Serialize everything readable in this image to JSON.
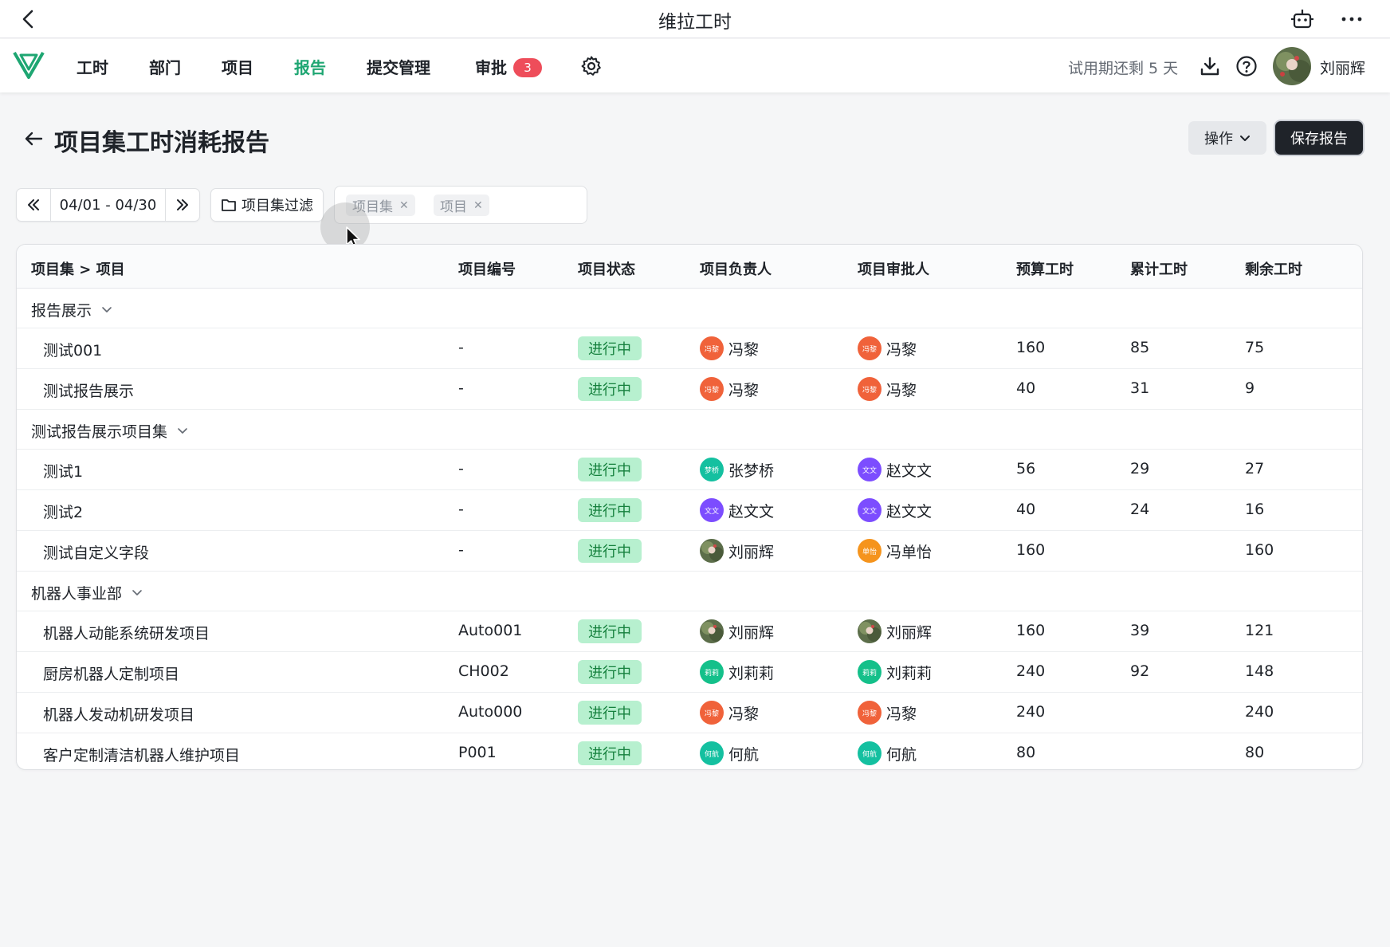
{
  "app": {
    "title": "维拉工时"
  },
  "nav": {
    "items": [
      {
        "label": "工时",
        "active": false
      },
      {
        "label": "部门",
        "active": false
      },
      {
        "label": "项目",
        "active": false
      },
      {
        "label": "报告",
        "active": true
      },
      {
        "label": "提交管理",
        "active": false
      },
      {
        "label": "审批",
        "active": false
      }
    ],
    "approval_badge": "3",
    "trial_text": "试用期还剩 5 天",
    "user_name": "刘丽辉"
  },
  "page": {
    "title": "项目集工时消耗报告",
    "ops_label": "操作",
    "save_label": "保存报告"
  },
  "filters": {
    "date_range": "04/01 - 04/30",
    "filter_label": "项目集过滤",
    "tags": [
      "项目集",
      "项目"
    ]
  },
  "table": {
    "headers": [
      "项目集 > 项目",
      "项目编号",
      "项目状态",
      "项目负责人",
      "项目审批人",
      "预算工时",
      "累计工时",
      "剩余工时"
    ],
    "groups": [
      {
        "name": "报告展示",
        "rows": [
          {
            "name": "测试001",
            "code": "-",
            "status": "进行中",
            "owner": {
              "name": "冯黎",
              "abbr": "冯黎",
              "color": "#f0623a"
            },
            "approver": {
              "name": "冯黎",
              "abbr": "冯黎",
              "color": "#f0623a"
            },
            "budget": "160",
            "spent": "85",
            "remaining": "75"
          },
          {
            "name": "测试报告展示",
            "code": "-",
            "status": "进行中",
            "owner": {
              "name": "冯黎",
              "abbr": "冯黎",
              "color": "#f0623a"
            },
            "approver": {
              "name": "冯黎",
              "abbr": "冯黎",
              "color": "#f0623a"
            },
            "budget": "40",
            "spent": "31",
            "remaining": "9"
          }
        ]
      },
      {
        "name": "测试报告展示项目集",
        "rows": [
          {
            "name": "测试1",
            "code": "-",
            "status": "进行中",
            "owner": {
              "name": "张梦桥",
              "abbr": "梦桥",
              "color": "#14c0a0"
            },
            "approver": {
              "name": "赵文文",
              "abbr": "文文",
              "color": "#7c4dff"
            },
            "budget": "56",
            "spent": "29",
            "remaining": "27"
          },
          {
            "name": "测试2",
            "code": "-",
            "status": "进行中",
            "owner": {
              "name": "赵文文",
              "abbr": "文文",
              "color": "#7c4dff"
            },
            "approver": {
              "name": "赵文文",
              "abbr": "文文",
              "color": "#7c4dff"
            },
            "budget": "40",
            "spent": "24",
            "remaining": "16"
          },
          {
            "name": "测试自定义字段",
            "code": "-",
            "status": "进行中",
            "owner": {
              "name": "刘丽辉",
              "abbr": "photo",
              "color": "#6b7a5a"
            },
            "approver": {
              "name": "冯单怡",
              "abbr": "单怡",
              "color": "#f5941d"
            },
            "budget": "160",
            "spent": "",
            "remaining": "160"
          }
        ]
      },
      {
        "name": "机器人事业部",
        "rows": [
          {
            "name": "机器人动能系统研发项目",
            "code": "Auto001",
            "status": "进行中",
            "owner": {
              "name": "刘丽辉",
              "abbr": "photo",
              "color": "#6b7a5a"
            },
            "approver": {
              "name": "刘丽辉",
              "abbr": "photo",
              "color": "#6b7a5a"
            },
            "budget": "160",
            "spent": "39",
            "remaining": "121"
          },
          {
            "name": "厨房机器人定制项目",
            "code": "CH002",
            "status": "进行中",
            "owner": {
              "name": "刘莉莉",
              "abbr": "莉莉",
              "color": "#14c08a"
            },
            "approver": {
              "name": "刘莉莉",
              "abbr": "莉莉",
              "color": "#14c08a"
            },
            "budget": "240",
            "spent": "92",
            "remaining": "148"
          },
          {
            "name": "机器人发动机研发项目",
            "code": "Auto000",
            "status": "进行中",
            "owner": {
              "name": "冯黎",
              "abbr": "冯黎",
              "color": "#f0623a"
            },
            "approver": {
              "name": "冯黎",
              "abbr": "冯黎",
              "color": "#f0623a"
            },
            "budget": "240",
            "spent": "",
            "remaining": "240"
          },
          {
            "name": "客户定制清洁机器人维护项目",
            "code": "P001",
            "status": "进行中",
            "owner": {
              "name": "何航",
              "abbr": "何航",
              "color": "#14c0a0"
            },
            "approver": {
              "name": "何航",
              "abbr": "何航",
              "color": "#14c0a0"
            },
            "budget": "80",
            "spent": "",
            "remaining": "80"
          }
        ]
      }
    ]
  }
}
